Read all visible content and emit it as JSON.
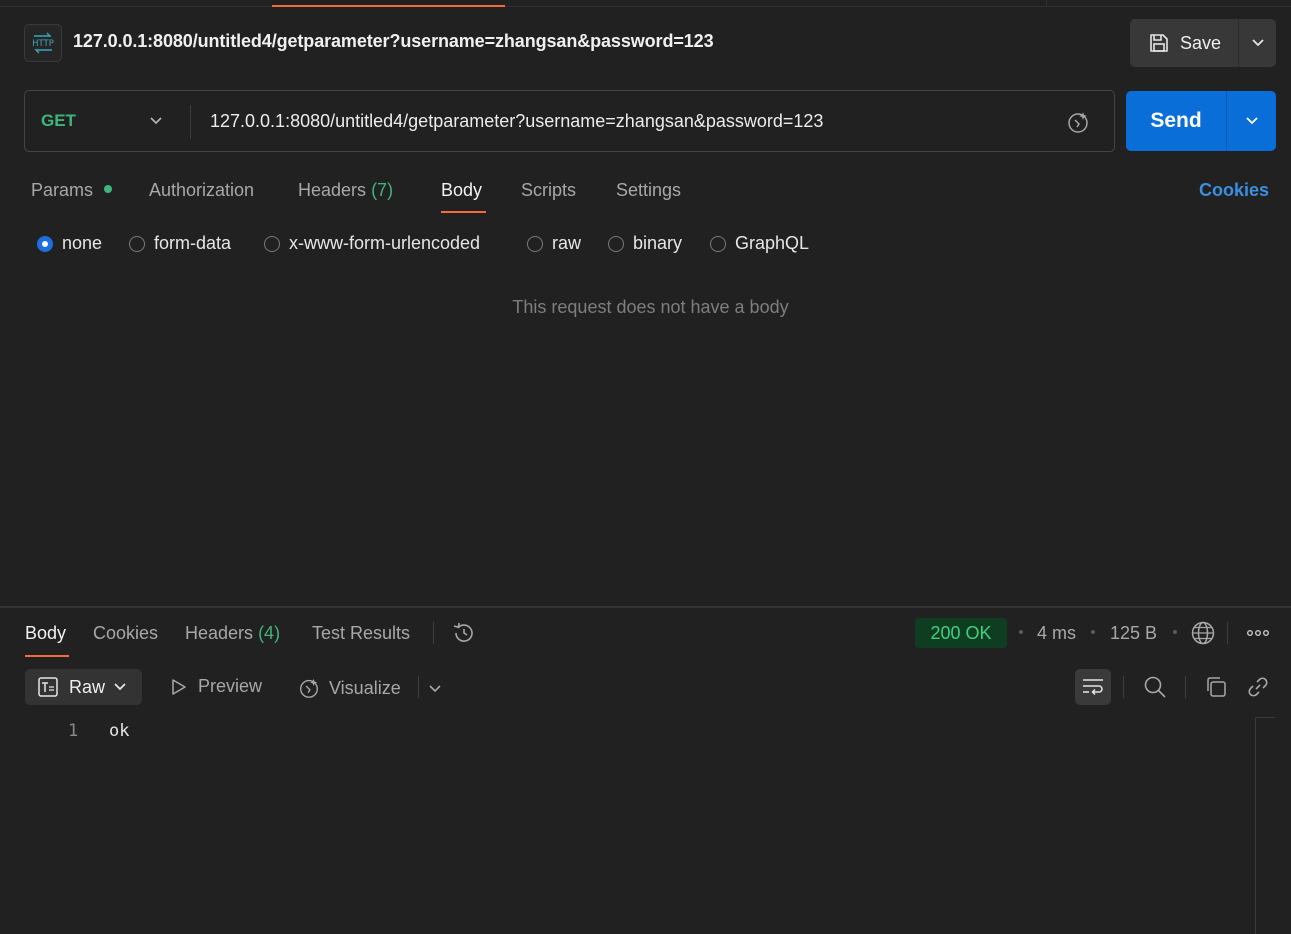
{
  "request": {
    "badge": "HTTP",
    "title": "127.0.0.1:8080/untitled4/getparameter?username=zhangsan&password=123",
    "save_label": "Save",
    "method": "GET",
    "url": "127.0.0.1:8080/untitled4/getparameter?username=zhangsan&password=123",
    "send_label": "Send"
  },
  "request_tabs": {
    "params": "Params",
    "authorization": "Authorization",
    "headers": "Headers",
    "headers_count": "(7)",
    "body": "Body",
    "scripts": "Scripts",
    "settings": "Settings",
    "cookies": "Cookies"
  },
  "body_types": {
    "none": "none",
    "form_data": "form-data",
    "urlencoded": "x-www-form-urlencoded",
    "raw": "raw",
    "binary": "binary",
    "graphql": "GraphQL",
    "selected": "none"
  },
  "empty_body_message": "This request does not have a body",
  "response": {
    "tabs": {
      "body": "Body",
      "cookies": "Cookies",
      "headers": "Headers",
      "headers_count": "(4)",
      "test_results": "Test Results"
    },
    "status": "200 OK",
    "time": "4 ms",
    "size": "125 B",
    "format": "Raw",
    "preview": "Preview",
    "visualize": "Visualize",
    "lines": [
      {
        "num": "1",
        "text": "ok"
      }
    ]
  },
  "colors": {
    "accent_orange": "#f26b3a",
    "send_blue": "#0a6ed8",
    "success_green": "#3fb47d",
    "link_blue": "#3a8fe0"
  }
}
